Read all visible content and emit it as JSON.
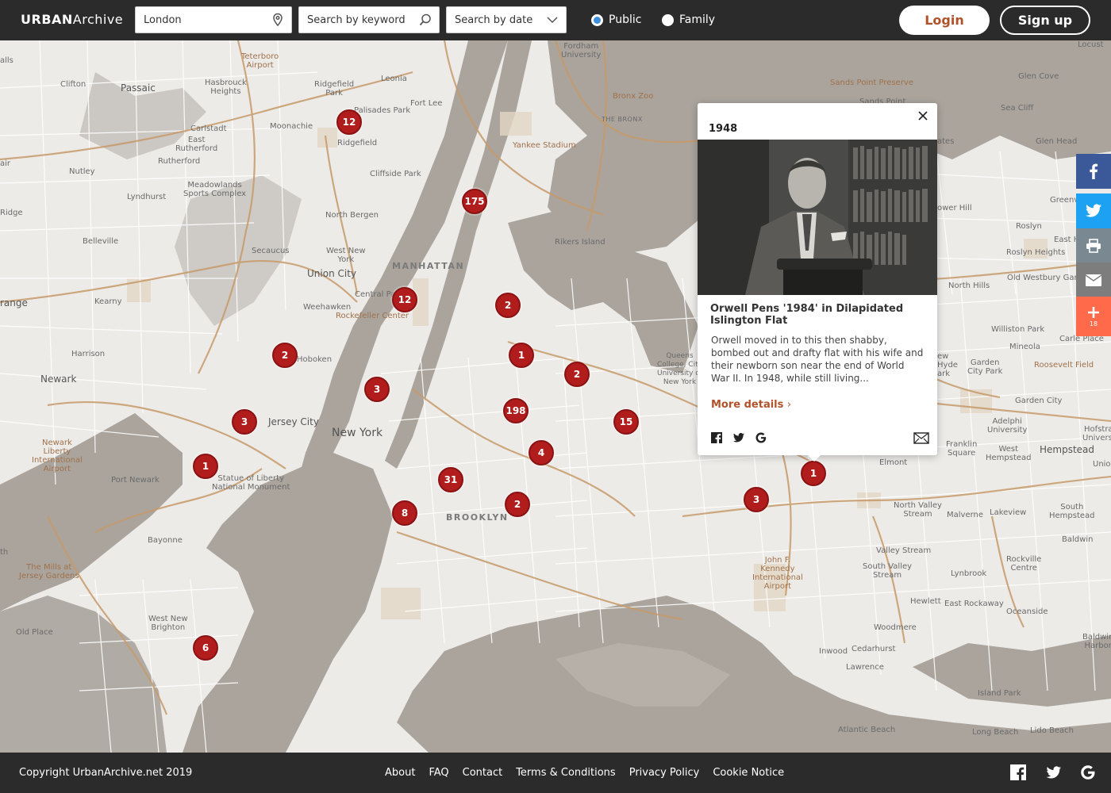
{
  "header": {
    "logo_bold": "URBAN",
    "logo_light": "Archive",
    "location_value": "London",
    "keyword_placeholder": "Search by keyword",
    "date_placeholder": "Search by date",
    "radio_public": "Public",
    "radio_family": "Family",
    "login": "Login",
    "signup": "Sign up"
  },
  "map": {
    "labels": {
      "clifton": "Clifton",
      "passaic": "Passaic",
      "hasbrouck": "Hasbrouck\nHeights",
      "teterboro": "Teterboro\nAirport",
      "ridgefield_park": "Ridgefield\nPark",
      "leonia": "Leonia",
      "fort_lee": "Fort Lee",
      "fordham": "Fordham\nUniversity",
      "bronx_zoo": "Bronx Zoo",
      "the_bronx": "THE BRONX",
      "sands_point": "Sands Point Preserve",
      "sands_point2": "Sands Point",
      "glen_cove": "Glen Cove",
      "sea_cliff": "Sea Cliff",
      "glen_head": "Glen Head",
      "carlstadt": "Carlstadt",
      "moonachie": "Moonachie",
      "palisades": "Palisades Park",
      "east_rutherford": "East\nRutherford",
      "ridgefield": "Ridgefield",
      "yankee": "Yankee Stadium",
      "rutherford": "Rutherford",
      "nutley": "Nutley",
      "meadowlands": "Meadowlands\nSports Complex",
      "cliffside": "Cliffside Park",
      "lyndhurst": "Lyndhurst",
      "ridge": "Ridge",
      "north_bergen": "North Bergen",
      "belleville": "Belleville",
      "secaucus": "Secaucus",
      "rikers": "Rikers Island",
      "west_new_york": "West New\nYork",
      "manhattan": "MANHATTAN",
      "union_city": "Union City",
      "range": "range",
      "kearny": "Kearny",
      "central_park": "Central Park",
      "weehawken": "Weehawken",
      "rockefeller": "Rockefeller Center",
      "harrison": "Harrison",
      "hoboken": "Hoboken",
      "queens_college": "Queens\nCollege, City\nUniversity of\nNew York",
      "newark": "Newark",
      "jersey_city": "Jersey City",
      "new_york": "New York",
      "newark_airport": "Newark\nLiberty\nInternational\nAirport",
      "port_newark": "Port Newark",
      "statue": "Statue of Liberty\nNational Monument",
      "brooklyn": "BROOKLYN",
      "bayonne": "Bayonne",
      "th": "th",
      "mills": "The Mills at\nJersey Gardens",
      "west_new_brighton": "West New\nBrighton",
      "old_place": "Old Place",
      "jfk": "John F.\nKennedy\nInternational\nAirport",
      "elmont": "Elmont",
      "north_valley": "North Valley\nStream",
      "malverne": "Malverne",
      "lakeview": "Lakeview",
      "south_hempstead": "South\nHempstead",
      "hempstead": "Hempstead",
      "union_r": "Union",
      "west_hempstead": "West\nHempstead",
      "franklin_sq": "Franklin\nSquare",
      "valley_stream": "Valley Stream",
      "south_valley": "South Valley\nStream",
      "lynbrook": "Lynbrook",
      "rockville": "Rockville\nCentre",
      "baldwin": "Baldwin",
      "hewlett": "Hewlett",
      "east_rockaway": "East Rockaway",
      "oceanside": "Oceanside",
      "woodmere": "Woodmere",
      "inwood": "Inwood",
      "cedarhurst": "Cedarhurst",
      "lawrence": "Lawrence",
      "baldwin_harbor": "Baldwin\nHarbor",
      "island_park": "Island Park",
      "atlantic_beach": "Atlantic Beach",
      "long_beach": "Long Beach",
      "lido_beach": "Lido Beach",
      "hofstra": "Hofstra\nUniversi",
      "adelphi": "Adelphi\nUniversity",
      "garden_city": "Garden City",
      "garden_city_park": "Garden\nCity Park",
      "roosevelt": "Roosevelt Field",
      "mineola": "Mineola",
      "williston": "Williston Park",
      "carle": "Carle Place",
      "north_hills": "North Hills",
      "old_westbury": "Old Westbury Gard",
      "roslyn_heights": "Roslyn Heights",
      "roslyn": "Roslyn",
      "east_hills": "East Hills",
      "greenvale": "Greenvale",
      "ower_hill": "ower Hill",
      "ates": "ates",
      "alls": "alls",
      "air": "air",
      "lake_success": "ew\nHyde\nark",
      "locust": "Locust"
    },
    "markers": [
      {
        "id": "m1",
        "count": "12"
      },
      {
        "id": "m2",
        "count": "175"
      },
      {
        "id": "m3",
        "count": "12"
      },
      {
        "id": "m4",
        "count": "2"
      },
      {
        "id": "m5",
        "count": "2"
      },
      {
        "id": "m6",
        "count": "1"
      },
      {
        "id": "m7",
        "count": "2"
      },
      {
        "id": "m8",
        "count": "3"
      },
      {
        "id": "m9",
        "count": "198"
      },
      {
        "id": "m10",
        "count": "15"
      },
      {
        "id": "m11",
        "count": "3"
      },
      {
        "id": "m12",
        "count": "4"
      },
      {
        "id": "m13",
        "count": "1"
      },
      {
        "id": "m14",
        "count": "31"
      },
      {
        "id": "m15",
        "count": "2"
      },
      {
        "id": "m16",
        "count": "8"
      },
      {
        "id": "m17",
        "count": "1"
      },
      {
        "id": "m18",
        "count": "3"
      },
      {
        "id": "m19",
        "count": "6"
      }
    ]
  },
  "popup": {
    "year": "1948",
    "title": "Orwell Pens '1984' in Dilapidated Islington Flat",
    "description": "Orwell moved in to this then shabby, bombed out and drafty flat with his wife and their newborn son near the end of World War II. In 1948, while still living...",
    "more": "More details"
  },
  "share": {
    "count": "18"
  },
  "footer": {
    "copyright": "Copyright UrbanArchive.net 2019",
    "links": [
      "About",
      "FAQ",
      "Contact",
      "Terms & Conditions",
      "Privacy Policy",
      "Cookie Notice"
    ]
  },
  "colors": {
    "accent": "#b0522a",
    "marker": "#b11d1d",
    "road": "#c79a6a",
    "water": "#aaa49d",
    "land": "#ecebe8"
  }
}
